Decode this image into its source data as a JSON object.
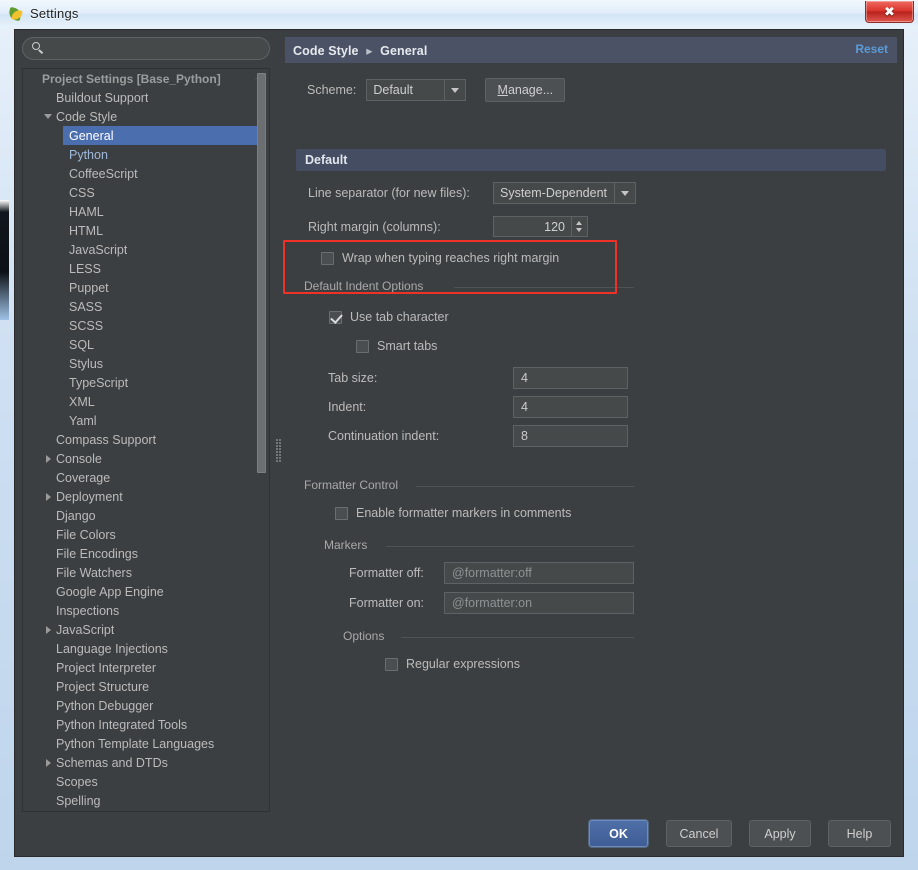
{
  "window": {
    "title": "Settings",
    "icon": "pycharm-icon",
    "close_label": "✖"
  },
  "sidebar": {
    "search": {
      "value": "",
      "placeholder": "",
      "icon": "search-icon"
    },
    "items": [
      {
        "label": "Project Settings [Base_Python]",
        "indent": 0,
        "type": "group",
        "arrow": "none"
      },
      {
        "label": "Buildout Support",
        "indent": 1,
        "type": "item",
        "arrow": "none"
      },
      {
        "label": "Code Style",
        "indent": 1,
        "type": "item",
        "arrow": "down"
      },
      {
        "label": "General",
        "indent": 2,
        "type": "selected",
        "arrow": "none"
      },
      {
        "label": "Python",
        "indent": 2,
        "type": "python",
        "arrow": "none"
      },
      {
        "label": "CoffeeScript",
        "indent": 2,
        "type": "item",
        "arrow": "none"
      },
      {
        "label": "CSS",
        "indent": 2,
        "type": "item",
        "arrow": "none"
      },
      {
        "label": "HAML",
        "indent": 2,
        "type": "item",
        "arrow": "none"
      },
      {
        "label": "HTML",
        "indent": 2,
        "type": "item",
        "arrow": "none"
      },
      {
        "label": "JavaScript",
        "indent": 2,
        "type": "item",
        "arrow": "none"
      },
      {
        "label": "LESS",
        "indent": 2,
        "type": "item",
        "arrow": "none"
      },
      {
        "label": "Puppet",
        "indent": 2,
        "type": "item",
        "arrow": "none"
      },
      {
        "label": "SASS",
        "indent": 2,
        "type": "item",
        "arrow": "none"
      },
      {
        "label": "SCSS",
        "indent": 2,
        "type": "item",
        "arrow": "none"
      },
      {
        "label": "SQL",
        "indent": 2,
        "type": "item",
        "arrow": "none"
      },
      {
        "label": "Stylus",
        "indent": 2,
        "type": "item",
        "arrow": "none"
      },
      {
        "label": "TypeScript",
        "indent": 2,
        "type": "item",
        "arrow": "none"
      },
      {
        "label": "XML",
        "indent": 2,
        "type": "item",
        "arrow": "none"
      },
      {
        "label": "Yaml",
        "indent": 2,
        "type": "item",
        "arrow": "none"
      },
      {
        "label": "Compass Support",
        "indent": 1,
        "type": "item",
        "arrow": "none"
      },
      {
        "label": "Console",
        "indent": 1,
        "type": "item",
        "arrow": "right"
      },
      {
        "label": "Coverage",
        "indent": 1,
        "type": "item",
        "arrow": "none"
      },
      {
        "label": "Deployment",
        "indent": 1,
        "type": "item",
        "arrow": "right"
      },
      {
        "label": "Django",
        "indent": 1,
        "type": "item",
        "arrow": "none"
      },
      {
        "label": "File Colors",
        "indent": 1,
        "type": "item",
        "arrow": "none"
      },
      {
        "label": "File Encodings",
        "indent": 1,
        "type": "item",
        "arrow": "none"
      },
      {
        "label": "File Watchers",
        "indent": 1,
        "type": "item",
        "arrow": "none"
      },
      {
        "label": "Google App Engine",
        "indent": 1,
        "type": "item",
        "arrow": "none"
      },
      {
        "label": "Inspections",
        "indent": 1,
        "type": "item",
        "arrow": "none"
      },
      {
        "label": "JavaScript",
        "indent": 1,
        "type": "item",
        "arrow": "right"
      },
      {
        "label": "Language Injections",
        "indent": 1,
        "type": "item",
        "arrow": "none"
      },
      {
        "label": "Project Interpreter",
        "indent": 1,
        "type": "item",
        "arrow": "none"
      },
      {
        "label": "Project Structure",
        "indent": 1,
        "type": "item",
        "arrow": "none"
      },
      {
        "label": "Python Debugger",
        "indent": 1,
        "type": "item",
        "arrow": "none"
      },
      {
        "label": "Python Integrated Tools",
        "indent": 1,
        "type": "item",
        "arrow": "none"
      },
      {
        "label": "Python Template Languages",
        "indent": 1,
        "type": "item",
        "arrow": "none"
      },
      {
        "label": "Schemas and DTDs",
        "indent": 1,
        "type": "item",
        "arrow": "right"
      },
      {
        "label": "Scopes",
        "indent": 1,
        "type": "item",
        "arrow": "none"
      },
      {
        "label": "Spelling",
        "indent": 1,
        "type": "item",
        "arrow": "none"
      }
    ]
  },
  "main": {
    "breadcrumb": {
      "parent": "Code Style",
      "separator": "▸",
      "current": "General"
    },
    "reset_label": "Reset",
    "scheme": {
      "label": "Scheme:",
      "value": "Default",
      "manage_prefix": "M",
      "manage_rest": "anage..."
    },
    "section_default": "Default",
    "line_separator": {
      "label": "Line separator (for new files):",
      "value": "System-Dependent"
    },
    "right_margin": {
      "label": "Right margin (columns):",
      "value": "120"
    },
    "wrap_checkbox": {
      "label": "Wrap when typing reaches right margin",
      "checked": false
    },
    "indent_group": {
      "title": "Default Indent Options",
      "use_tab": {
        "label": "Use tab character",
        "checked": true
      },
      "smart_tabs": {
        "label": "Smart tabs",
        "checked": false
      },
      "tab_size": {
        "label": "Tab size:",
        "value": "4"
      },
      "indent": {
        "label": "Indent:",
        "value": "4"
      },
      "continuation_indent": {
        "label": "Continuation indent:",
        "value": "8"
      }
    },
    "formatter_group": {
      "title": "Formatter Control",
      "enable_markers": {
        "label": "Enable formatter markers in comments",
        "checked": false
      },
      "markers_title": "Markers",
      "formatter_off": {
        "label": "Formatter off:",
        "value": "@formatter:off"
      },
      "formatter_on": {
        "label": "Formatter on:",
        "value": "@formatter:on"
      },
      "options_title": "Options",
      "regular_expressions": {
        "label": "Regular expressions",
        "checked": false
      }
    }
  },
  "footer": {
    "ok": "OK",
    "cancel": "Cancel",
    "apply": "Apply",
    "help": "Help"
  },
  "annotation": {
    "highlight_color": "#ef3127",
    "target": "Default Indent Options / Use tab character"
  }
}
